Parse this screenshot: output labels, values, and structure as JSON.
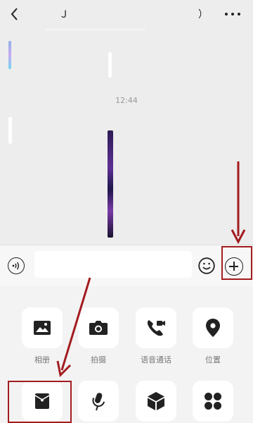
{
  "header": {
    "title": "Ｊ　　　　　　　　）",
    "back_icon": "chevron-left-icon",
    "more_icon": "more-horizontal-icon"
  },
  "chat": {
    "timestamp": "12:44"
  },
  "input": {
    "value": "",
    "placeholder": ""
  },
  "actions": [
    {
      "label": "相册",
      "icon": "image-icon"
    },
    {
      "label": "拍摄",
      "icon": "camera-icon"
    },
    {
      "label": "语音通话",
      "icon": "video-phone-icon"
    },
    {
      "label": "位置",
      "icon": "location-icon"
    },
    {
      "label": "",
      "icon": "red-envelope-icon"
    },
    {
      "label": "",
      "icon": "microphone-icon"
    },
    {
      "label": "",
      "icon": "cube-icon"
    },
    {
      "label": "",
      "icon": "four-dots-icon"
    }
  ],
  "colors": {
    "annotation_red": "#a31c20",
    "background": "#ededed",
    "icon_dark": "#222222"
  }
}
